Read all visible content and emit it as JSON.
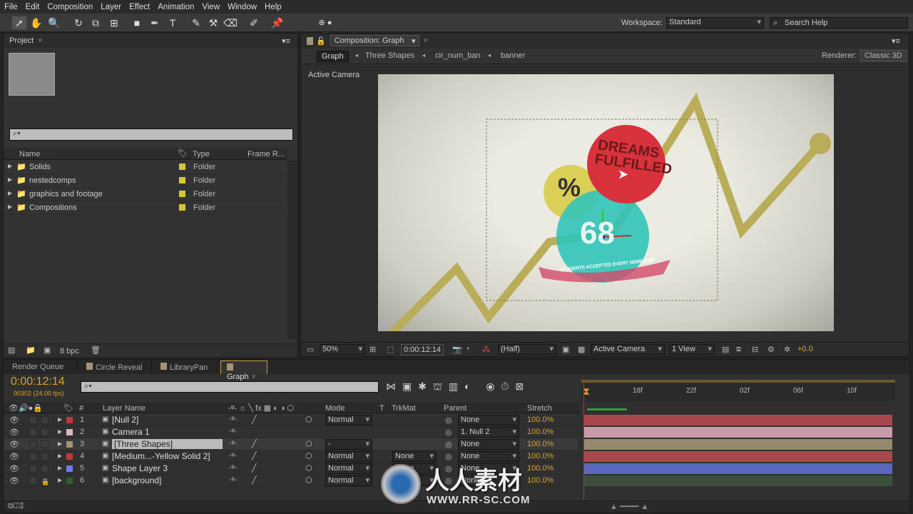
{
  "menu": [
    "File",
    "Edit",
    "Composition",
    "Layer",
    "Effect",
    "Animation",
    "View",
    "Window",
    "Help"
  ],
  "toolbar": {
    "workspace_label": "Workspace:",
    "workspace_value": "Standard",
    "search_placeholder": "Search Help"
  },
  "project": {
    "tab": "Project",
    "columns": [
      "Name",
      "Type",
      "Frame R..."
    ],
    "items": [
      {
        "name": "Solids",
        "type": "Folder"
      },
      {
        "name": "nestedcomps",
        "type": "Folder"
      },
      {
        "name": "graphics and footage",
        "type": "Folder"
      },
      {
        "name": "Compositions",
        "type": "Folder"
      }
    ],
    "bpc": "8 bpc",
    "label_color": "#d6c63a"
  },
  "comp": {
    "tab": "Composition: Graph",
    "breadcrumbs": [
      "Graph",
      "Three Shapes",
      "cir_num_ban",
      "banner"
    ],
    "renderer_label": "Renderer:",
    "renderer_value": "Classic 3D",
    "view_label": "Active Camera",
    "footer": {
      "zoom": "50%",
      "timecode": "0:00:12:14",
      "resolution": "(Half)",
      "camera": "Active Camera",
      "views": "1 View",
      "exposure": "+0.0"
    },
    "artwork": {
      "top_text": "DREAMS FULFILLED",
      "percent": "%",
      "number": "68",
      "banner": "STUDENTS ACCEPTED EVERY SEMESTER"
    }
  },
  "timeline": {
    "tabs": [
      "Render Queue",
      "Circle Reveal",
      "LibraryPan",
      "Graph"
    ],
    "active_tab": "Graph",
    "timecode": "0:00:12:14",
    "frame_info": "00302 (24.00 fps)",
    "columns": {
      "num": "#",
      "name": "Layer Name",
      "mode": "Mode",
      "t": "T",
      "trkmat": "TrkMat",
      "parent": "Parent",
      "stretch": "Stretch"
    },
    "ruler": [
      "18f",
      "22f",
      "02f",
      "06f",
      "10f"
    ],
    "layers": [
      {
        "num": "1",
        "name": "[Null 2]",
        "color": "#c0393a",
        "mode": "Normal",
        "trkmat": "",
        "parent": "None",
        "stretch": "100.0%",
        "bar": "#a8484c"
      },
      {
        "num": "2",
        "name": "Camera 1",
        "color": "#d8b6c4",
        "mode": "",
        "trkmat": "",
        "parent": "1. Null 2",
        "stretch": "100.0%",
        "bar": "#c99aa8"
      },
      {
        "num": "3",
        "name": "[Three Shapes]",
        "color": "#a39476",
        "mode": "-",
        "trkmat": "",
        "parent": "None",
        "stretch": "100.0%",
        "bar": "#958a6c"
      },
      {
        "num": "4",
        "name": "[Medium...-Yellow Solid 2]",
        "color": "#c0393a",
        "mode": "Normal",
        "trkmat": "None",
        "parent": "None",
        "stretch": "100.0%",
        "bar": "#a8484c"
      },
      {
        "num": "5",
        "name": "Shape Layer 3",
        "color": "#6a7fe0",
        "mode": "Normal",
        "trkmat": "None",
        "parent": "None",
        "stretch": "100.0%",
        "bar": "#5a69c0"
      },
      {
        "num": "6",
        "name": "[background]",
        "color": "#2f5e2f",
        "mode": "Normal",
        "trkmat": "None",
        "parent": "None",
        "stretch": "100.0%",
        "bar": "#3b4f3b"
      }
    ]
  },
  "watermark": {
    "text": "人人素材",
    "url": "www.rr-sc.com"
  }
}
